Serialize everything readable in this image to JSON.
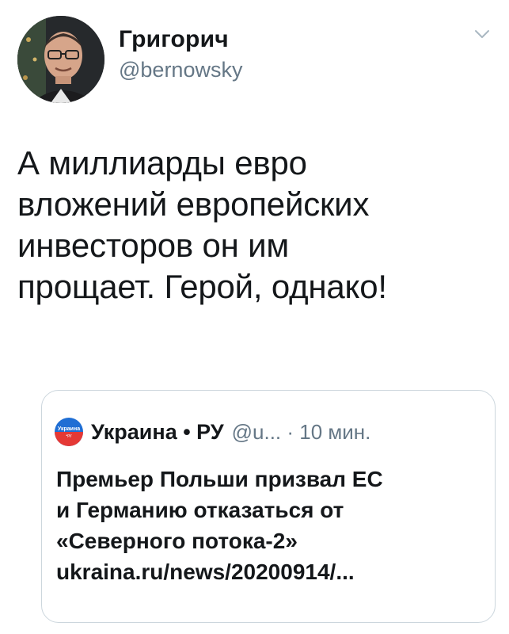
{
  "author": {
    "display_name": "Григорич",
    "handle": "@bernowsky"
  },
  "tweet": {
    "text": "А миллиарды евро\nвложений европейских\nинвесторов он им\nпрощает. Герой, однако!"
  },
  "quote": {
    "avatar_label_top": "Украина",
    "avatar_label_bottom": "•ру",
    "name": "Украина • РУ",
    "meta": "@u... · 10 мин.",
    "text": "Премьер Польши призвал ЕС\nи Германию отказаться от\n«Северного потока-2»\nukraina.ru/news/20200914/..."
  },
  "colors": {
    "text_primary": "#14171a",
    "text_secondary": "#657786",
    "border": "#ccd6dd",
    "quote_avatar_blue": "#1f6ed4",
    "quote_avatar_red": "#e53935"
  },
  "icons": {
    "chevron": "chevron-down-icon"
  }
}
